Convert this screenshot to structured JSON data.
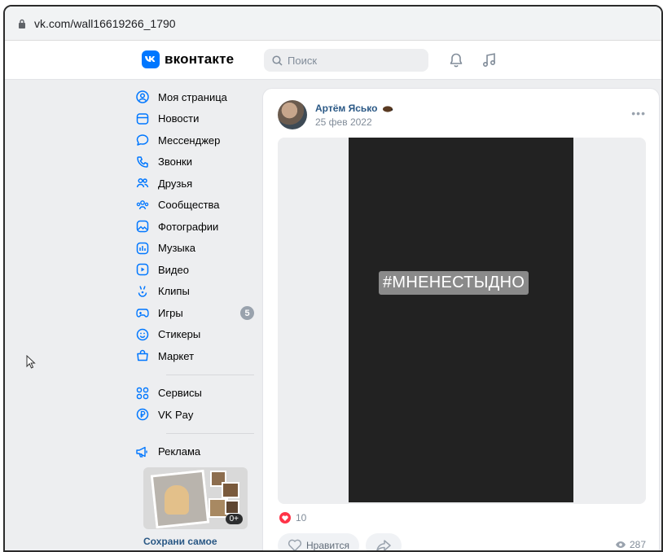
{
  "browser": {
    "url": "vk.com/wall16619266_1790"
  },
  "header": {
    "logo_text": "вконтакте",
    "search_placeholder": "Поиск"
  },
  "nav": {
    "items": [
      {
        "label": "Моя страница",
        "icon": "user-circle-icon"
      },
      {
        "label": "Новости",
        "icon": "newsfeed-icon"
      },
      {
        "label": "Мессенджер",
        "icon": "message-icon"
      },
      {
        "label": "Звонки",
        "icon": "phone-icon"
      },
      {
        "label": "Друзья",
        "icon": "friends-icon"
      },
      {
        "label": "Сообщества",
        "icon": "communities-icon"
      },
      {
        "label": "Фотографии",
        "icon": "photo-icon"
      },
      {
        "label": "Музыка",
        "icon": "music-icon"
      },
      {
        "label": "Видео",
        "icon": "video-icon"
      },
      {
        "label": "Клипы",
        "icon": "clips-icon"
      },
      {
        "label": "Игры",
        "icon": "gamepad-icon",
        "badge": "5"
      },
      {
        "label": "Стикеры",
        "icon": "smile-icon"
      },
      {
        "label": "Маркет",
        "icon": "bag-icon"
      }
    ],
    "services": [
      {
        "label": "Сервисы",
        "icon": "services-icon"
      },
      {
        "label": "VK Pay",
        "icon": "vkpay-icon"
      }
    ],
    "ads": {
      "label": "Реклама",
      "icon": "megaphone-icon"
    }
  },
  "promo": {
    "badge": "0+",
    "title": "Сохрани самое дорогое"
  },
  "post": {
    "author": "Артём Ясько",
    "date": "25 фев 2022",
    "more": "•••",
    "video_tag": "#МНЕНЕСТЫДНО",
    "likes_count": "10",
    "like_label": "Нравится",
    "views": "287"
  },
  "colors": {
    "accent": "#0077ff",
    "link": "#2a5885",
    "like": "#ff3347"
  }
}
